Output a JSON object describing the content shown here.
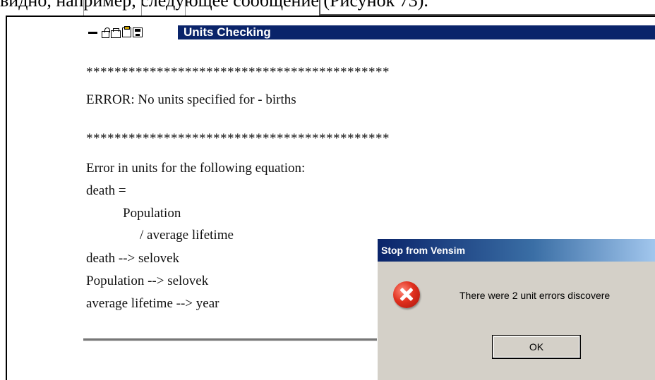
{
  "document": {
    "top_text": "видно, например, следующее сообщение (Рисунок 73)."
  },
  "units_window": {
    "title": "Units Checking",
    "toolbar_icons": [
      "minus-icon",
      "lock-icon",
      "print-icon",
      "clipboard-icon",
      "save-icon"
    ],
    "lines": {
      "stars1": "*******************************************",
      "error1": "ERROR:  No units specified for - births",
      "stars2": "*******************************************",
      "l1": "Error in units for the following equation:",
      "l2": "death =",
      "l3": "Population",
      "l4": "/ average lifetime",
      "l5": "death  --> selovek",
      "l6": "Population  --> selovek",
      "l7": "average lifetime  --> year"
    }
  },
  "dialog": {
    "title": "Stop from Vensim",
    "icon": "error-icon",
    "message": "There were 2 unit errors discovere",
    "ok_label": "OK"
  },
  "colors": {
    "title_bar": "#0a246a",
    "dialog_bg": "#d4d0c8"
  }
}
